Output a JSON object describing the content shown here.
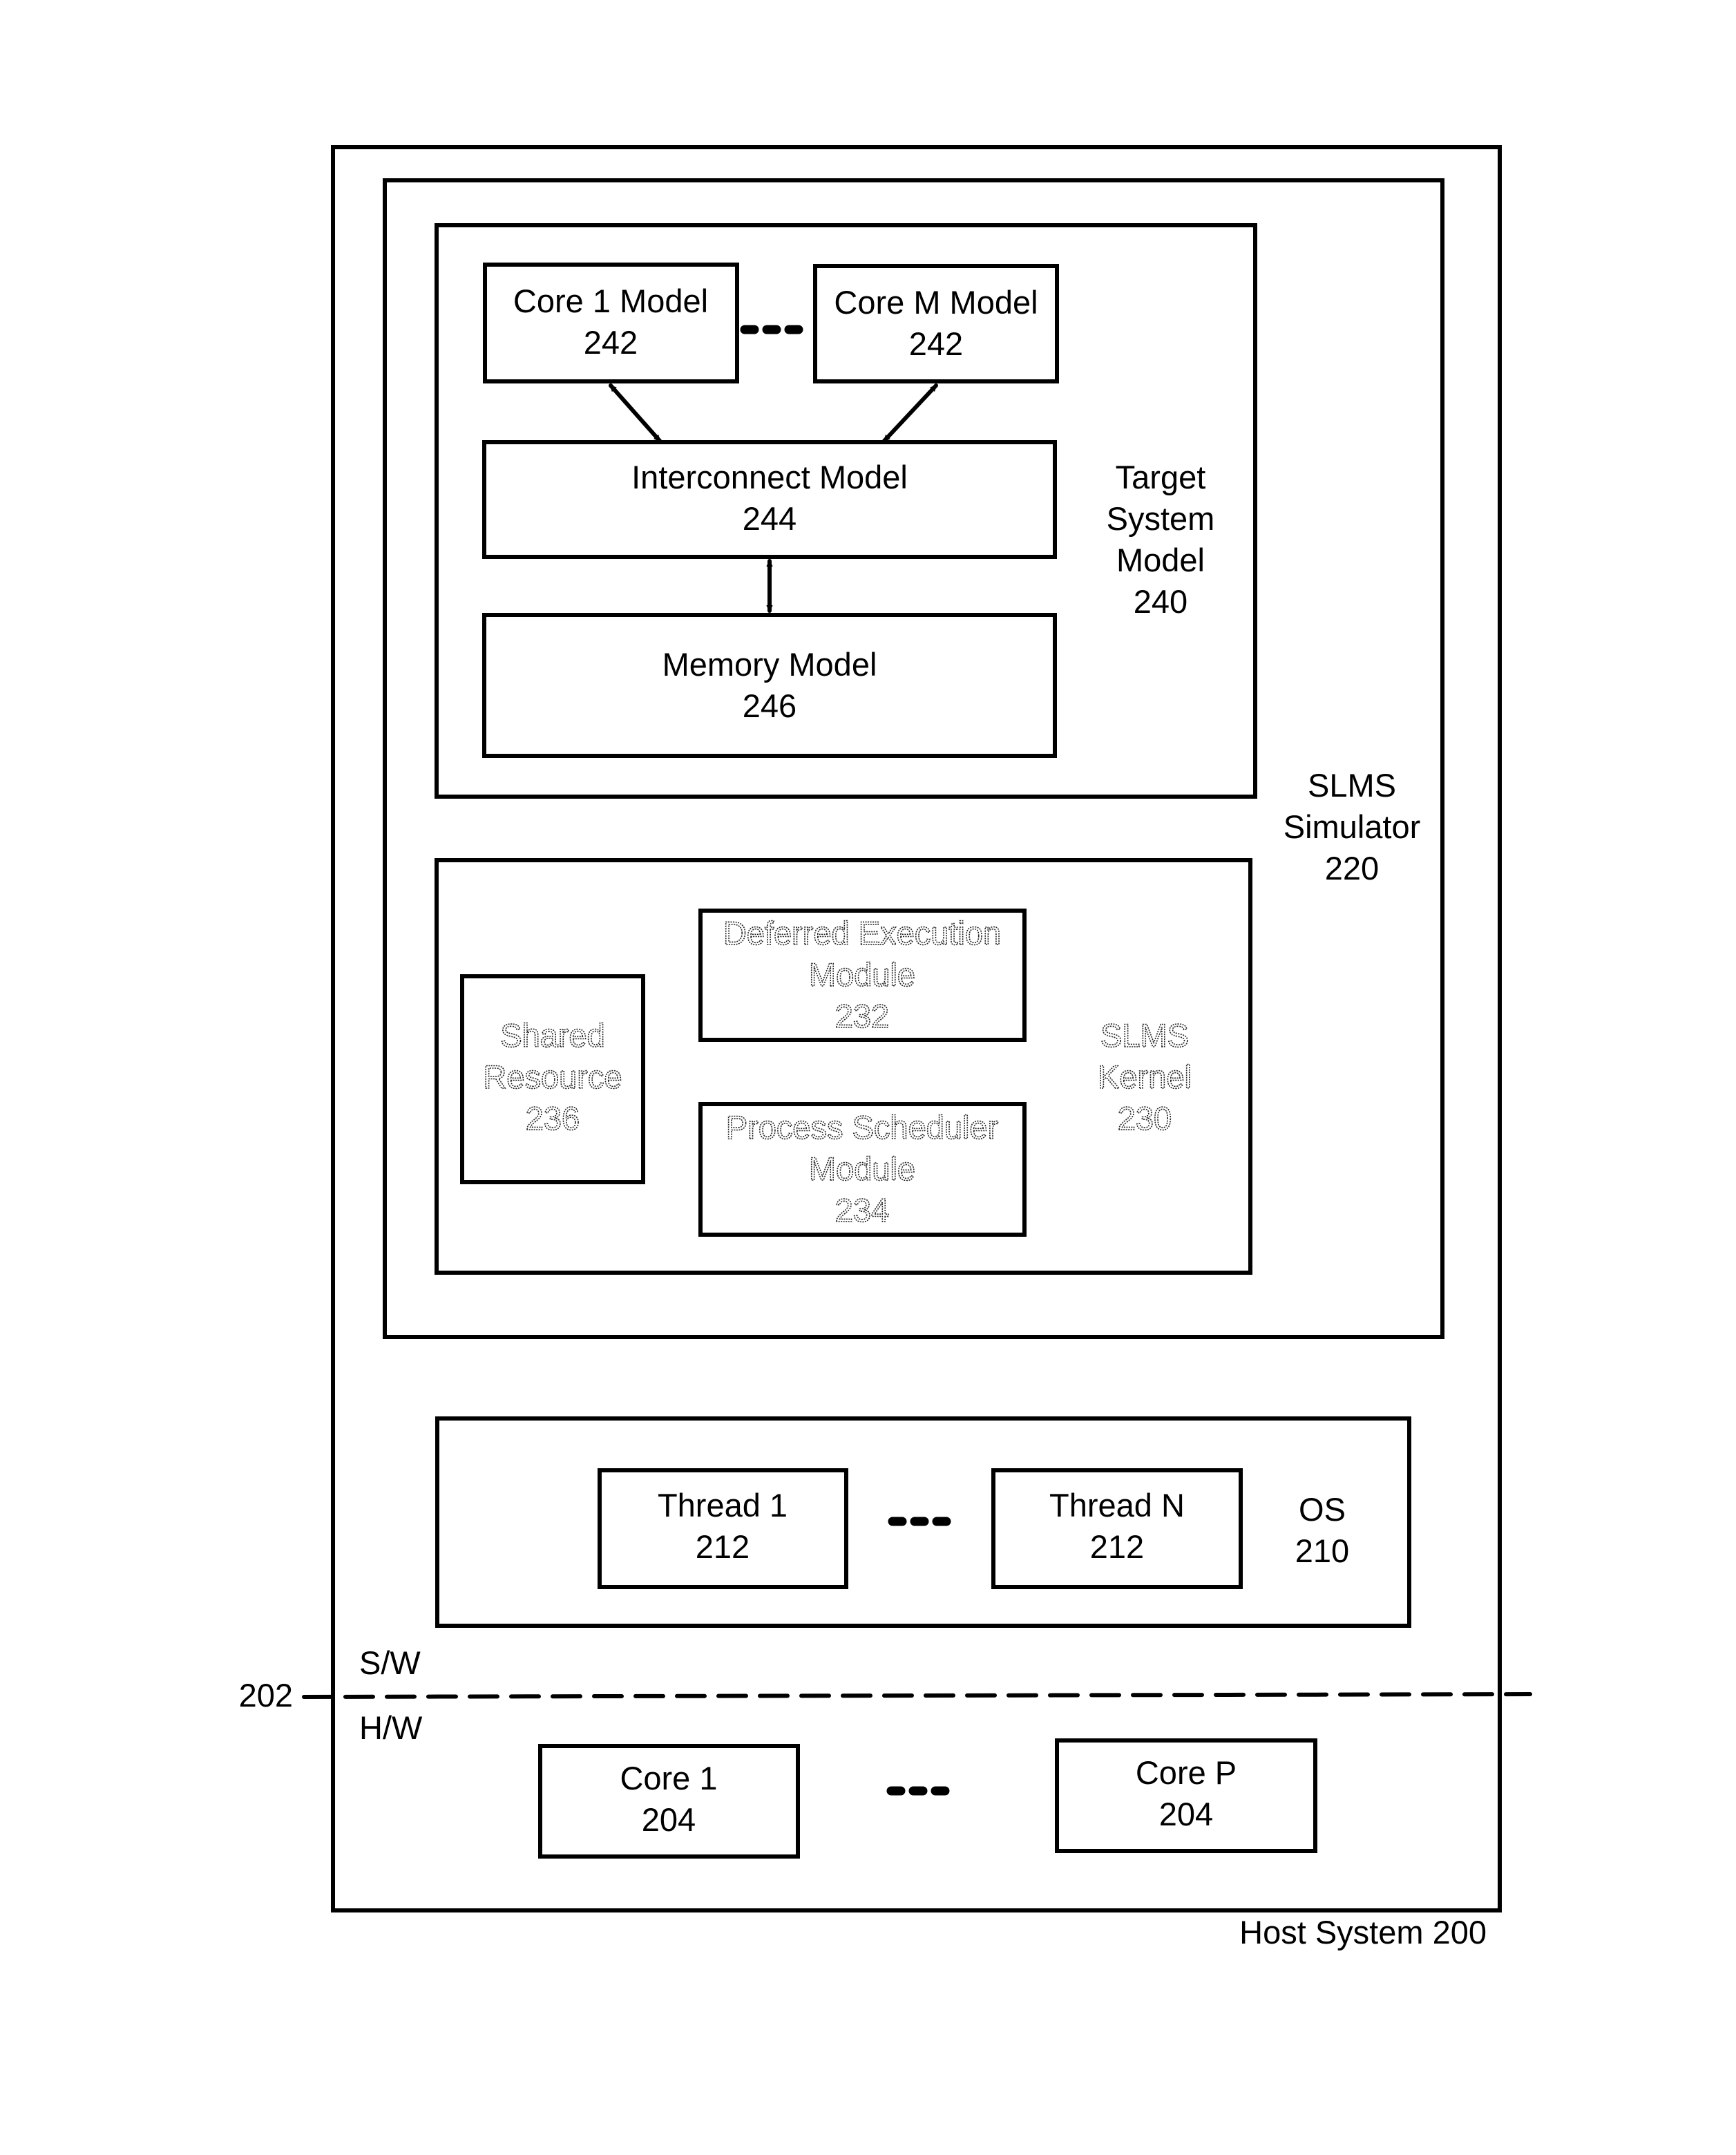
{
  "figure": {
    "host_system": {
      "label": "Host System 200"
    },
    "slms_simulator": {
      "lines": [
        "SLMS",
        "Simulator",
        "220"
      ]
    },
    "target_system_model": {
      "lines": [
        "Target",
        "System",
        "Model",
        "240"
      ],
      "core_first": {
        "name": "Core 1 Model",
        "ref": "242"
      },
      "core_last": {
        "name": "Core M Model",
        "ref": "242"
      },
      "interconnect": {
        "name": "Interconnect Model",
        "ref": "244"
      },
      "memory": {
        "name": "Memory Model",
        "ref": "246"
      }
    },
    "slms_kernel": {
      "lines": [
        "SLMS",
        "Kernel",
        "230"
      ],
      "deferred_execution": {
        "lines": [
          "Deferred Execution",
          "Module",
          "232"
        ]
      },
      "process_scheduler": {
        "lines": [
          "Process Scheduler",
          "Module",
          "234"
        ]
      },
      "shared_resource": {
        "lines": [
          "Shared",
          "Resource",
          "236"
        ]
      }
    },
    "os": {
      "lines": [
        "OS",
        "210"
      ],
      "thread_first": {
        "name": "Thread 1",
        "ref": "212"
      },
      "thread_last": {
        "name": "Thread N",
        "ref": "212"
      }
    },
    "boundary": {
      "ref": "202",
      "software_label": "S/W",
      "hardware_label": "H/W"
    },
    "hardware": {
      "core_first": {
        "name": "Core 1",
        "ref": "204"
      },
      "core_last": {
        "name": "Core P",
        "ref": "204"
      }
    }
  }
}
